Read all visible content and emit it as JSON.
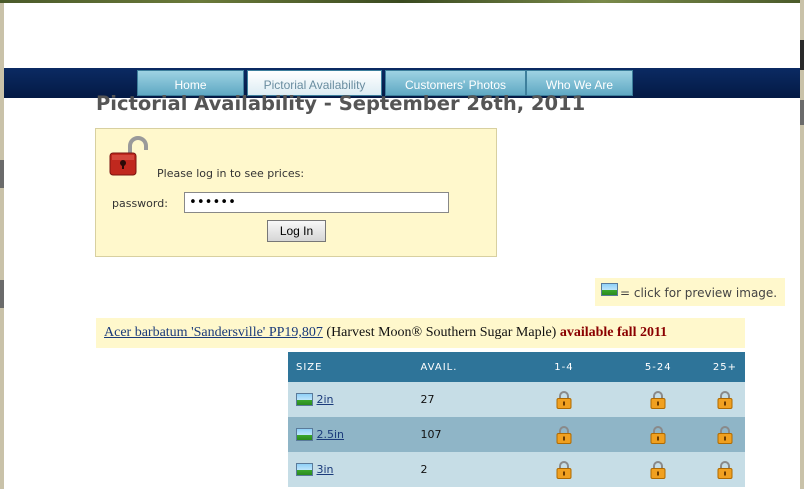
{
  "nav": {
    "tabs": [
      {
        "label": "Home"
      },
      {
        "label": "Pictorial Availability"
      },
      {
        "label": "Customers' Photos"
      },
      {
        "label": "Who We Are"
      }
    ],
    "active_index": 1
  },
  "page": {
    "title": "Pictorial Availability - September 26th, 2011"
  },
  "login": {
    "message": "Please log in to see prices:",
    "password_label": "password:",
    "password_value": "••••••",
    "button_label": "Log In"
  },
  "legend": {
    "text": "= click for preview image."
  },
  "product": {
    "name": "Acer barbatum 'Sandersville' PP19,807",
    "common_name": "(Harvest Moon® Southern Sugar Maple)",
    "availability": "available fall 2011"
  },
  "table": {
    "headers": [
      "SIZE",
      "AVAIL.",
      "1-4",
      "5-24",
      "25+"
    ],
    "rows": [
      {
        "size": "2in",
        "avail": "27"
      },
      {
        "size": "2.5in",
        "avail": "107"
      },
      {
        "size": "3in",
        "avail": "2"
      }
    ]
  },
  "colors": {
    "nav_bg": "#0b2a63",
    "tab_bg": "#5fa8c3",
    "login_bg": "#fff8cc",
    "table_header": "#2e7499",
    "avail_text": "#8a0000"
  }
}
